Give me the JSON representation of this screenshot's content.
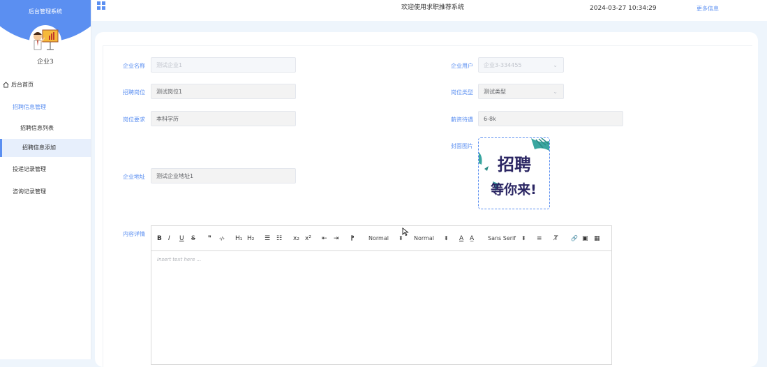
{
  "sidebar": {
    "title": "后台管理系统",
    "user": "企业3",
    "items": [
      {
        "label": "后台首页"
      },
      {
        "label": "招聘信息管理"
      },
      {
        "label": "招聘信息列表"
      },
      {
        "label": "招聘信息添加"
      },
      {
        "label": "投递记录管理"
      },
      {
        "label": "咨询记录管理"
      }
    ]
  },
  "header": {
    "welcome": "欢迎使用求职推荐系统",
    "datetime": "2024-03-27 10:34:29",
    "more": "更多信息"
  },
  "form": {
    "company_name": {
      "label": "企业名称",
      "value": "测试企业1"
    },
    "company_user": {
      "label": "企业用户",
      "value": "企业3-334455"
    },
    "job_title": {
      "label": "招聘岗位",
      "value": "测试岗位1"
    },
    "job_type": {
      "label": "岗位类型",
      "value": "测试类型"
    },
    "requirement": {
      "label": "岗位要求",
      "value": "本科学历"
    },
    "salary": {
      "label": "薪资待遇",
      "value": "6-8k"
    },
    "cover": {
      "label": "封面图片",
      "image_text_line1": "招聘",
      "image_text_line2": "等你来!"
    },
    "address": {
      "label": "企业地址",
      "value": "测试企业地址1"
    },
    "content": {
      "label": "内容详情",
      "placeholder": "Insert text here ..."
    }
  },
  "editor": {
    "toolbar": {
      "bold": "B",
      "italic": "I",
      "underline": "U",
      "strike": "S",
      "blockquote": "❞",
      "code": "‹/›",
      "h1": "H₁",
      "h2": "H₂",
      "ordered_list": "☰",
      "bullet_list": "☷",
      "subscript": "x₂",
      "superscript": "x²",
      "outdent": "⇤",
      "indent": "⇥",
      "direction": "⁋",
      "size": "Normal",
      "header": "Normal",
      "color": "A",
      "background": "A̲",
      "font": "Sans Serif",
      "align": "≡",
      "clean": "T̸",
      "link": "🔗",
      "image": "▣",
      "video": "▦"
    }
  }
}
